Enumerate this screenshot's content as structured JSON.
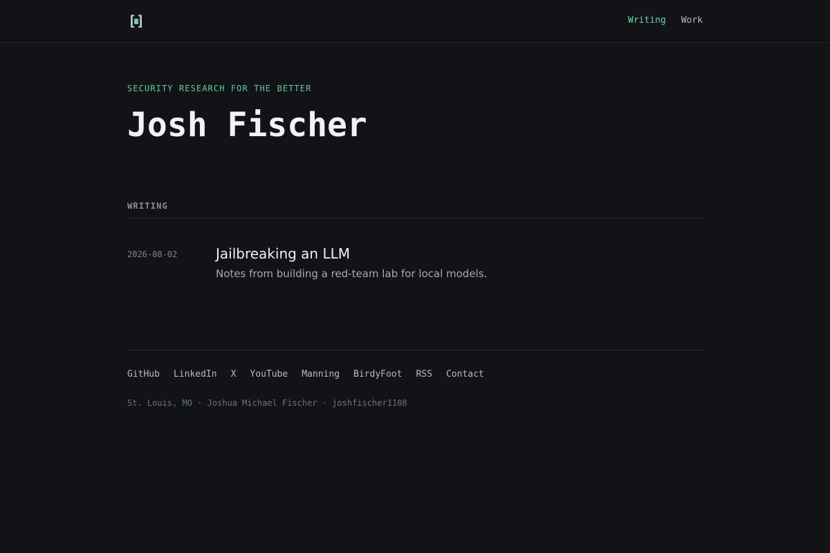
{
  "header": {
    "logo": {
      "left_bracket": "[",
      "right_bracket": "]",
      "accent_color": "#5fd3a3",
      "icon": "bracketed-square-logo"
    },
    "nav": [
      {
        "label": "Writing",
        "active": true
      },
      {
        "label": "Work",
        "active": false
      }
    ]
  },
  "hero": {
    "eyebrow": "SECURITY RESEARCH FOR THE BETTER",
    "title": "Josh Fischer"
  },
  "writing": {
    "heading": "WRITING",
    "posts": [
      {
        "date": "2026-08-02",
        "title": "Jailbreaking an LLM",
        "summary": "Notes from building a red-team lab for local models."
      }
    ]
  },
  "footer": {
    "links": [
      "GitHub",
      "LinkedIn",
      "X",
      "YouTube",
      "Manning",
      "BirdyFoot",
      "RSS",
      "Contact"
    ],
    "meta": "St. Louis, MO · Joshua Michael Fischer · joshfischer1108"
  },
  "theme": {
    "background": "#111317",
    "accent": "#58cf9c",
    "text": "#e8e9eb",
    "muted": "#8c9096",
    "divider": "#2b2f34"
  }
}
